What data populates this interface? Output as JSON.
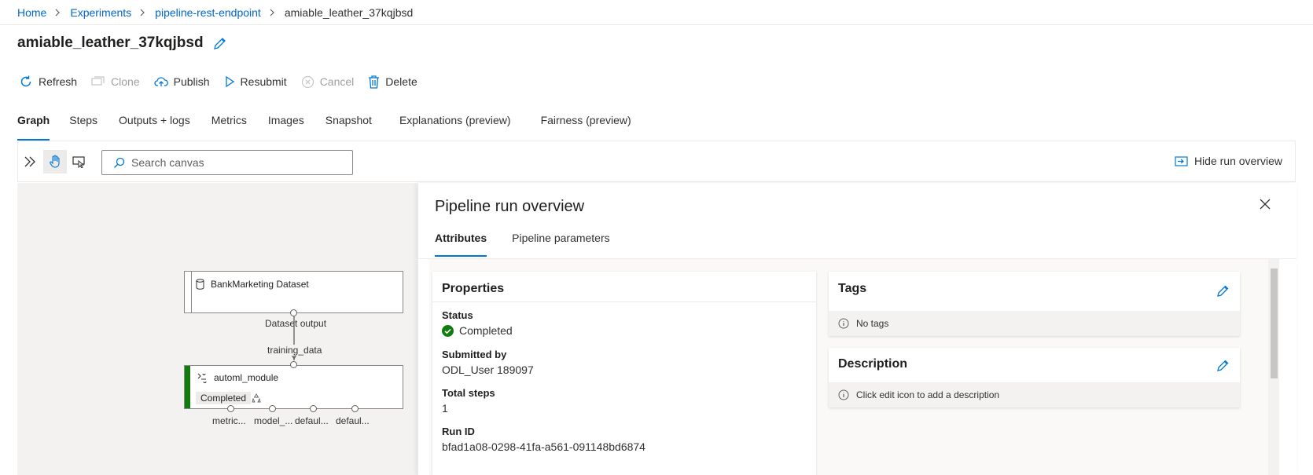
{
  "breadcrumb": {
    "items": [
      "Home",
      "Experiments",
      "pipeline-rest-endpoint"
    ],
    "current": "amiable_leather_37kqjbsd"
  },
  "title": "amiable_leather_37kqjbsd",
  "commands": {
    "refresh": "Refresh",
    "clone": "Clone",
    "publish": "Publish",
    "resubmit": "Resubmit",
    "cancel": "Cancel",
    "delete": "Delete"
  },
  "tabs": [
    "Graph",
    "Steps",
    "Outputs + logs",
    "Metrics",
    "Images",
    "Snapshot",
    "Explanations (preview)",
    "Fairness (preview)"
  ],
  "canvas_toolbar": {
    "search_placeholder": "Search canvas",
    "hide_overview": "Hide run overview"
  },
  "graph": {
    "dataset_node": {
      "title": "BankMarketing Dataset",
      "output_label": "Dataset output"
    },
    "edge_label": "training_data",
    "module_node": {
      "title": "automl_module",
      "status": "Completed",
      "outputs": [
        "metric...",
        "model_...",
        "defaul...",
        "defaul..."
      ]
    }
  },
  "overview": {
    "title": "Pipeline run overview",
    "tabs": [
      "Attributes",
      "Pipeline parameters"
    ],
    "properties": {
      "heading": "Properties",
      "status_label": "Status",
      "status_value": "Completed",
      "submitted_label": "Submitted by",
      "submitted_value": "ODL_User 189097",
      "steps_label": "Total steps",
      "steps_value": "1",
      "runid_label": "Run ID",
      "runid_value": "bfad1a08-0298-41fa-a561-091148bd6874"
    },
    "tags": {
      "heading": "Tags",
      "empty": "No tags"
    },
    "description": {
      "heading": "Description",
      "empty": "Click edit icon to add a description"
    }
  },
  "colors": {
    "accent": "#0078d4",
    "success": "#107c10",
    "link": "#0066cc"
  }
}
